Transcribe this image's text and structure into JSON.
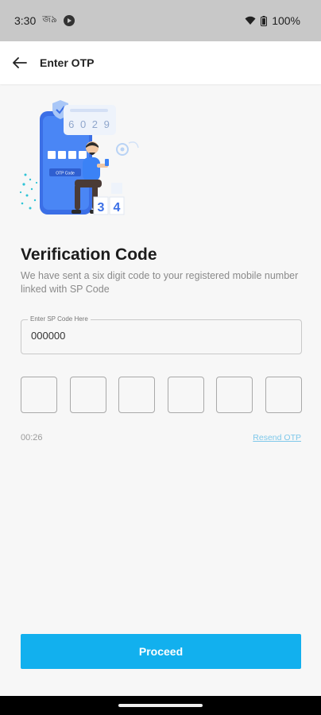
{
  "status_bar": {
    "time": "3:30",
    "left_glyph": "জ৯",
    "battery": "100%",
    "icons": [
      "play-icon",
      "wifi-icon",
      "battery-icon"
    ]
  },
  "app_bar": {
    "title": "Enter OTP",
    "back_icon": "arrow-left-icon"
  },
  "illustration": {
    "code_digits": "6 0 2 9",
    "screen_button": "OTP Code",
    "floor_digits": [
      "3",
      "4"
    ]
  },
  "main": {
    "heading": "Verification Code",
    "subtext": "We have sent a six digit code to your registered mobile number linked with SP Code",
    "sp_field": {
      "label": "Enter SP Code Here",
      "value": "000000"
    },
    "otp_boxes": [
      "",
      "",
      "",
      "",
      "",
      ""
    ],
    "timer": "00:26",
    "resend_label": "Resend OTP",
    "proceed_label": "Proceed"
  },
  "colors": {
    "accent": "#12b0ee",
    "resend": "#7ec8ea",
    "status_bar": "#c8c8c8",
    "illustration_blue": "#3b82f6"
  }
}
